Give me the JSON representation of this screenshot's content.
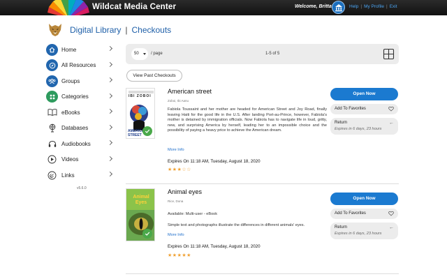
{
  "header": {
    "app_title": "Wildcat Media Center",
    "welcome": "Welcome, Britta!",
    "links": [
      "Help",
      "My Profile",
      "Exit"
    ]
  },
  "breadcrumb": {
    "section": "Digital Library",
    "separator": "|",
    "page": "Checkouts"
  },
  "sidebar": {
    "items": [
      {
        "label": "Home",
        "icon": "home-icon"
      },
      {
        "label": "All Resources",
        "icon": "compass-icon"
      },
      {
        "label": "Groups",
        "icon": "groups-icon"
      },
      {
        "label": "Categories",
        "icon": "categories-icon"
      },
      {
        "label": "eBooks",
        "icon": "book-icon"
      },
      {
        "label": "Databases",
        "icon": "globe-icon"
      },
      {
        "label": "Audiobooks",
        "icon": "headphones-icon"
      },
      {
        "label": "Videos",
        "icon": "play-icon"
      },
      {
        "label": "Links",
        "icon": "link-icon"
      }
    ],
    "version": "v5.6.0"
  },
  "toolbar": {
    "per_page_value": "50",
    "per_page_label": "/ page",
    "range": "1-5 of 5"
  },
  "past_checkouts_label": "View Past Checkouts",
  "checkouts": [
    {
      "title": "American street",
      "author": "Zoboi, Ibi Aanu",
      "description": "Fabiola Toussaint and her mother are headed for American Street and Joy Road, finally leaving Haiti for the good life in the U.S. After landing Port-au-Prince, however, Fabiola's mother is detained by immigration officials. Now Fabiola has to navigate life in loud, gritty, new, and surprising America by herself, leading her to an impossible choice and the possibility of paying a heavy price to achieve the American dream.",
      "more_info": "More Info",
      "expires": "Expires On 11:18 AM, Tuesday, August 18, 2020",
      "rating": 3,
      "cover_text_top": "IBI ZOBOI",
      "cover_text_bottom": "AMERICAN STREET",
      "open_label": "Open Now",
      "favorites_label": "Add To Favorites",
      "return_label": "Return",
      "return_note": "Expires in 6 days, 23 hours"
    },
    {
      "title": "Animal eyes",
      "author": "Rice, Dona",
      "availability": "Available: Multi-user - eBook",
      "description": "Simple text and photographs illustrate the differences in different animals' eyes.",
      "more_info": "More Info",
      "expires": "Expires On 11:18 AM, Tuesday, August 18, 2020",
      "rating": 5,
      "cover_text_top": "Animal Eyes",
      "open_label": "Open Now",
      "favorites_label": "Add To Favorites",
      "return_label": "Return",
      "return_note": "Expires in 6 days, 23 hours"
    }
  ],
  "colors": {
    "brand_blue": "#1e5fa8",
    "button_blue": "#1b7ad0",
    "topbar": "#1a1a1a",
    "star": "#f0a030",
    "check_green": "#4aa84a"
  }
}
